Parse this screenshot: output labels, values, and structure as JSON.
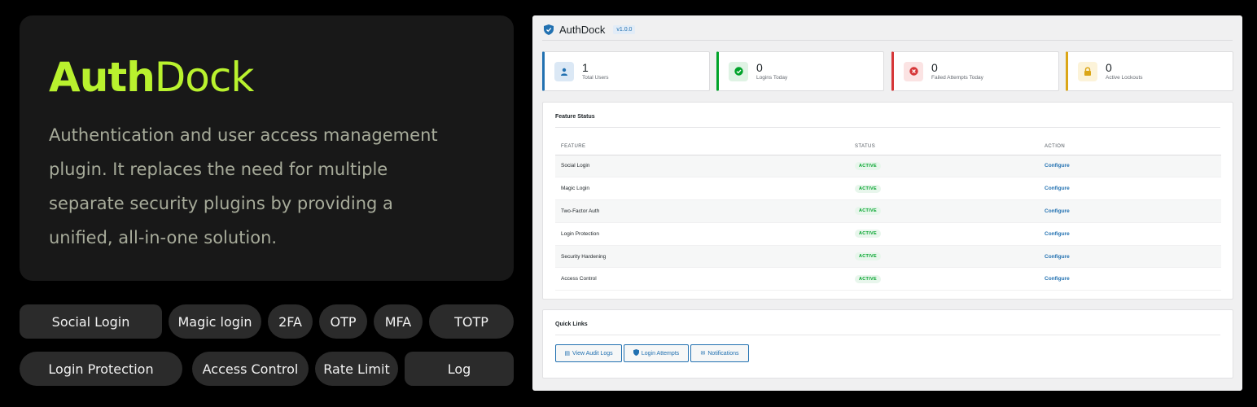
{
  "hero": {
    "brand_bold": "Auth",
    "brand_light": "Dock",
    "tagline": "Authentication and user access management plugin. It replaces the need for multiple separate security plugins by providing a unified, all-in-one solution."
  },
  "tags": [
    "Social Login",
    "Magic login",
    "2FA",
    "OTP",
    "MFA",
    "TOTP",
    "Login Protection",
    "Access Control",
    "Rate Limit",
    "Log"
  ],
  "admin": {
    "title": "AuthDock",
    "version": "v1.0.0",
    "stats": [
      {
        "value": "1",
        "label": "Total Users",
        "icon": "user-icon",
        "color": "#2271b1"
      },
      {
        "value": "0",
        "label": "Logins Today",
        "icon": "check-circle-icon",
        "color": "#00a32a"
      },
      {
        "value": "0",
        "label": "Failed Attempts Today",
        "icon": "x-circle-icon",
        "color": "#d63638"
      },
      {
        "value": "0",
        "label": "Active Lockouts",
        "icon": "lock-icon",
        "color": "#dba617"
      }
    ],
    "feature_status": {
      "heading": "Feature Status",
      "columns": [
        "FEATURE",
        "STATUS",
        "ACTION"
      ],
      "rows": [
        {
          "feature": "Social Login",
          "status": "ACTIVE",
          "action": "Configure"
        },
        {
          "feature": "Magic Login",
          "status": "ACTIVE",
          "action": "Configure"
        },
        {
          "feature": "Two-Factor Auth",
          "status": "ACTIVE",
          "action": "Configure"
        },
        {
          "feature": "Login Protection",
          "status": "ACTIVE",
          "action": "Configure"
        },
        {
          "feature": "Security Hardening",
          "status": "ACTIVE",
          "action": "Configure"
        },
        {
          "feature": "Access Control",
          "status": "ACTIVE",
          "action": "Configure"
        }
      ]
    },
    "quick_links": {
      "heading": "Quick Links",
      "links": [
        {
          "label": "View Audit Logs",
          "icon": "list-icon"
        },
        {
          "label": "Login Attempts",
          "icon": "shield-icon"
        },
        {
          "label": "Notifications",
          "icon": "mail-icon"
        }
      ]
    }
  }
}
